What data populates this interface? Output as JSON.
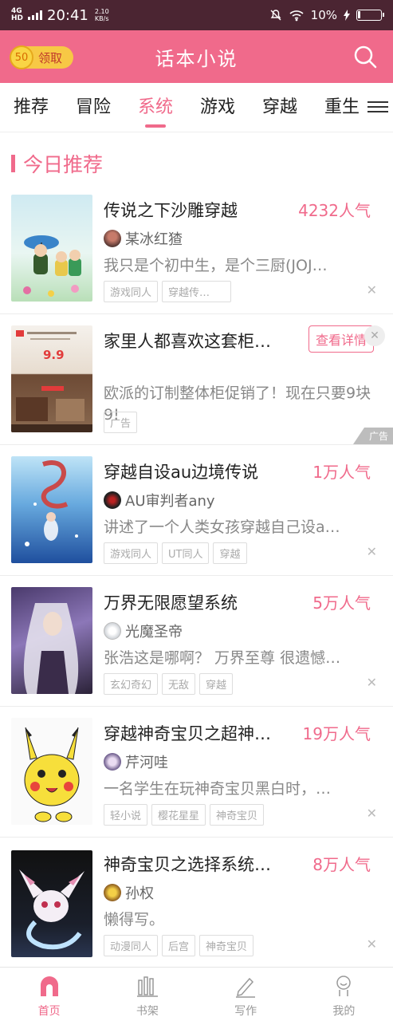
{
  "status_bar": {
    "network": "4G",
    "network_sub": "HD",
    "time": "20:41",
    "speed_value": "2.10",
    "speed_unit": "KB/s",
    "battery": "10%"
  },
  "header": {
    "reward_coin": "50",
    "reward_label": "领取",
    "title": "话本小说",
    "search_icon": "search-icon"
  },
  "tabs": [
    "推荐",
    "冒险",
    "系统",
    "游戏",
    "穿越",
    "重生"
  ],
  "active_tab": "系统",
  "section": {
    "title": "今日推荐"
  },
  "books": [
    {
      "title": "传说之下沙雕穿越",
      "popularity": "4232人气",
      "author": "某冰红猹",
      "desc": "我只是个初中生，是个三厨(JOJ…",
      "tags": [
        "游戏同人",
        "穿越传…"
      ]
    },
    {
      "title": "穿越自设au边境传说",
      "popularity": "1万人气",
      "author": "AU审判者any",
      "desc": "讲述了一个人类女孩穿越自己设a…",
      "tags": [
        "游戏同人",
        "UT同人",
        "穿越"
      ]
    },
    {
      "title": "万界无限愿望系统",
      "popularity": "5万人气",
      "author": "光魔圣帝",
      "desc": "张浩这是哪啊？ 万界至尊 很遗憾…",
      "tags": [
        "玄幻奇幻",
        "无敌",
        "穿越"
      ]
    },
    {
      "title": "穿越神奇宝贝之超神…",
      "popularity": "19万人气",
      "author": "芹河哇",
      "desc": "一名学生在玩神奇宝贝黑白时，…",
      "tags": [
        "轻小说",
        "樱花星星",
        "神奇宝贝"
      ]
    },
    {
      "title": "神奇宝贝之选择系统…",
      "popularity": "8万人气",
      "author": "孙权",
      "desc": "懒得写。",
      "tags": [
        "动漫同人",
        "后宫",
        "神奇宝贝"
      ]
    }
  ],
  "ad": {
    "title": "家里人都喜欢这套柜…",
    "detail_button": "查看详情",
    "desc": "欧派的订制整体柜促销了！现在只要9块9!",
    "tag": "广告",
    "mark": "广告",
    "image_text": "9.9"
  },
  "bottom_nav": [
    {
      "label": "首页",
      "icon": "home-icon"
    },
    {
      "label": "书架",
      "icon": "bookshelf-icon"
    },
    {
      "label": "写作",
      "icon": "pen-icon"
    },
    {
      "label": "我的",
      "icon": "profile-icon"
    }
  ],
  "colors": {
    "accent": "#f06a8b",
    "status_bar": "#4b2532"
  }
}
